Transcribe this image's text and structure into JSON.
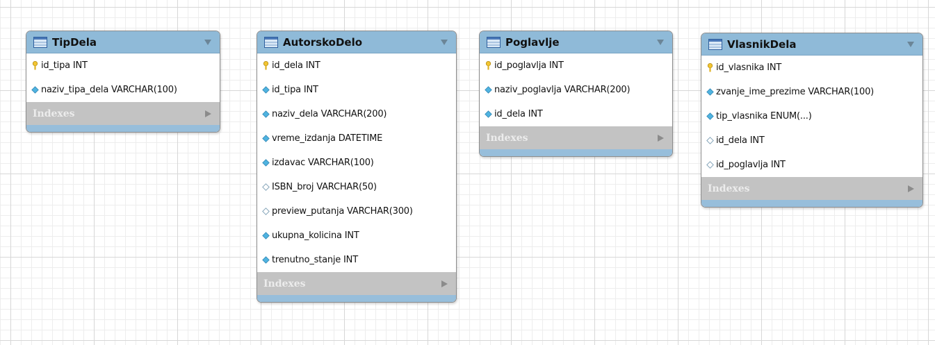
{
  "icons": {
    "table": "table-icon",
    "primary_key": "key-icon",
    "not_null_column": "filled-diamond-icon",
    "nullable_column": "hollow-diamond-icon",
    "collapse": "triangle-down-icon",
    "expand": "triangle-right-icon"
  },
  "colors": {
    "header": "#8fbad8",
    "footer": "#97bedb",
    "indexes_bar": "#c3c3c3",
    "key": "#f2c531",
    "diamond_filled": "#4fb3e0"
  },
  "entities": [
    {
      "title": "TipDela",
      "columns": [
        {
          "label": "id_tipa INT",
          "kind": "primary_key"
        },
        {
          "label": "naziv_tipa_dela VARCHAR(100)",
          "kind": "not_null"
        }
      ],
      "indexes_label": "Indexes"
    },
    {
      "title": "AutorskoDelo",
      "columns": [
        {
          "label": "id_dela INT",
          "kind": "primary_key"
        },
        {
          "label": "id_tipa INT",
          "kind": "not_null"
        },
        {
          "label": "naziv_dela VARCHAR(200)",
          "kind": "not_null"
        },
        {
          "label": "vreme_izdanja DATETIME",
          "kind": "not_null"
        },
        {
          "label": "izdavac VARCHAR(100)",
          "kind": "not_null"
        },
        {
          "label": "ISBN_broj VARCHAR(50)",
          "kind": "nullable"
        },
        {
          "label": "preview_putanja VARCHAR(300)",
          "kind": "nullable"
        },
        {
          "label": "ukupna_kolicina INT",
          "kind": "not_null"
        },
        {
          "label": "trenutno_stanje INT",
          "kind": "not_null"
        }
      ],
      "indexes_label": "Indexes"
    },
    {
      "title": "Poglavlje",
      "columns": [
        {
          "label": "id_poglavlja INT",
          "kind": "primary_key"
        },
        {
          "label": "naziv_poglavlja VARCHAR(200)",
          "kind": "not_null"
        },
        {
          "label": "id_dela INT",
          "kind": "not_null"
        }
      ],
      "indexes_label": "Indexes"
    },
    {
      "title": "VlasnikDela",
      "columns": [
        {
          "label": "id_vlasnika INT",
          "kind": "primary_key"
        },
        {
          "label": "zvanje_ime_prezime VARCHAR(100)",
          "kind": "not_null"
        },
        {
          "label": "tip_vlasnika ENUM(...)",
          "kind": "not_null"
        },
        {
          "label": "id_dela INT",
          "kind": "nullable"
        },
        {
          "label": "id_poglavlja INT",
          "kind": "nullable"
        }
      ],
      "indexes_label": "Indexes"
    }
  ]
}
